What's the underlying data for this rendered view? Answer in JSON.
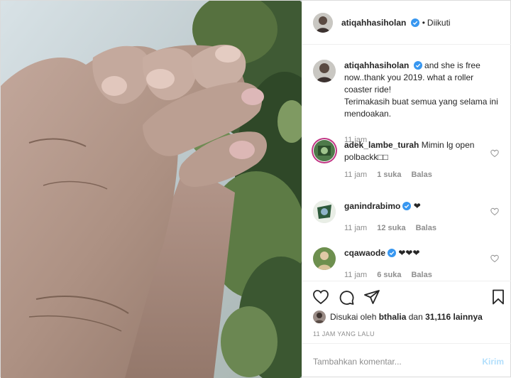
{
  "post": {
    "image_description_icon": "photo-icon",
    "owner": {
      "username": "atiqahhasiholan",
      "verified": true,
      "follow_status": "Diikuti",
      "separator": "•"
    },
    "caption": {
      "username": "atiqahhasiholan",
      "text": "and she is free now..thank you 2019. what a roller coaster ride!",
      "text2": "Terimakasih buat semua yang selama ini mendoakan.",
      "time": "11 jam"
    },
    "comments": [
      {
        "username": "adek_lambe_turah",
        "verified": false,
        "text": "Mimin lg open polbackk□□",
        "time": "11 jam",
        "likes": "1 suka",
        "reply": "Balas"
      },
      {
        "username": "ganindrabimo",
        "verified": true,
        "text": "❤",
        "time": "11 jam",
        "likes": "12 suka",
        "reply": "Balas"
      },
      {
        "username": "cqawaode",
        "verified": true,
        "text": "❤❤❤",
        "time": "11 jam",
        "likes": "6 suka",
        "reply": "Balas"
      }
    ],
    "likes_line": {
      "prefix": "Disukai oleh",
      "user": "bthalia",
      "mid": "dan",
      "count": "31,116 lainnya"
    },
    "timestamp": "11 JAM YANG LALU",
    "composer": {
      "placeholder": "Tambahkan komentar...",
      "send_label": "Kirim"
    },
    "colors": {
      "verified": "#3897f0",
      "text": "#262626",
      "muted": "#8e8e8e",
      "send_disabled": "#b2dffc",
      "border": "#efefef"
    }
  }
}
